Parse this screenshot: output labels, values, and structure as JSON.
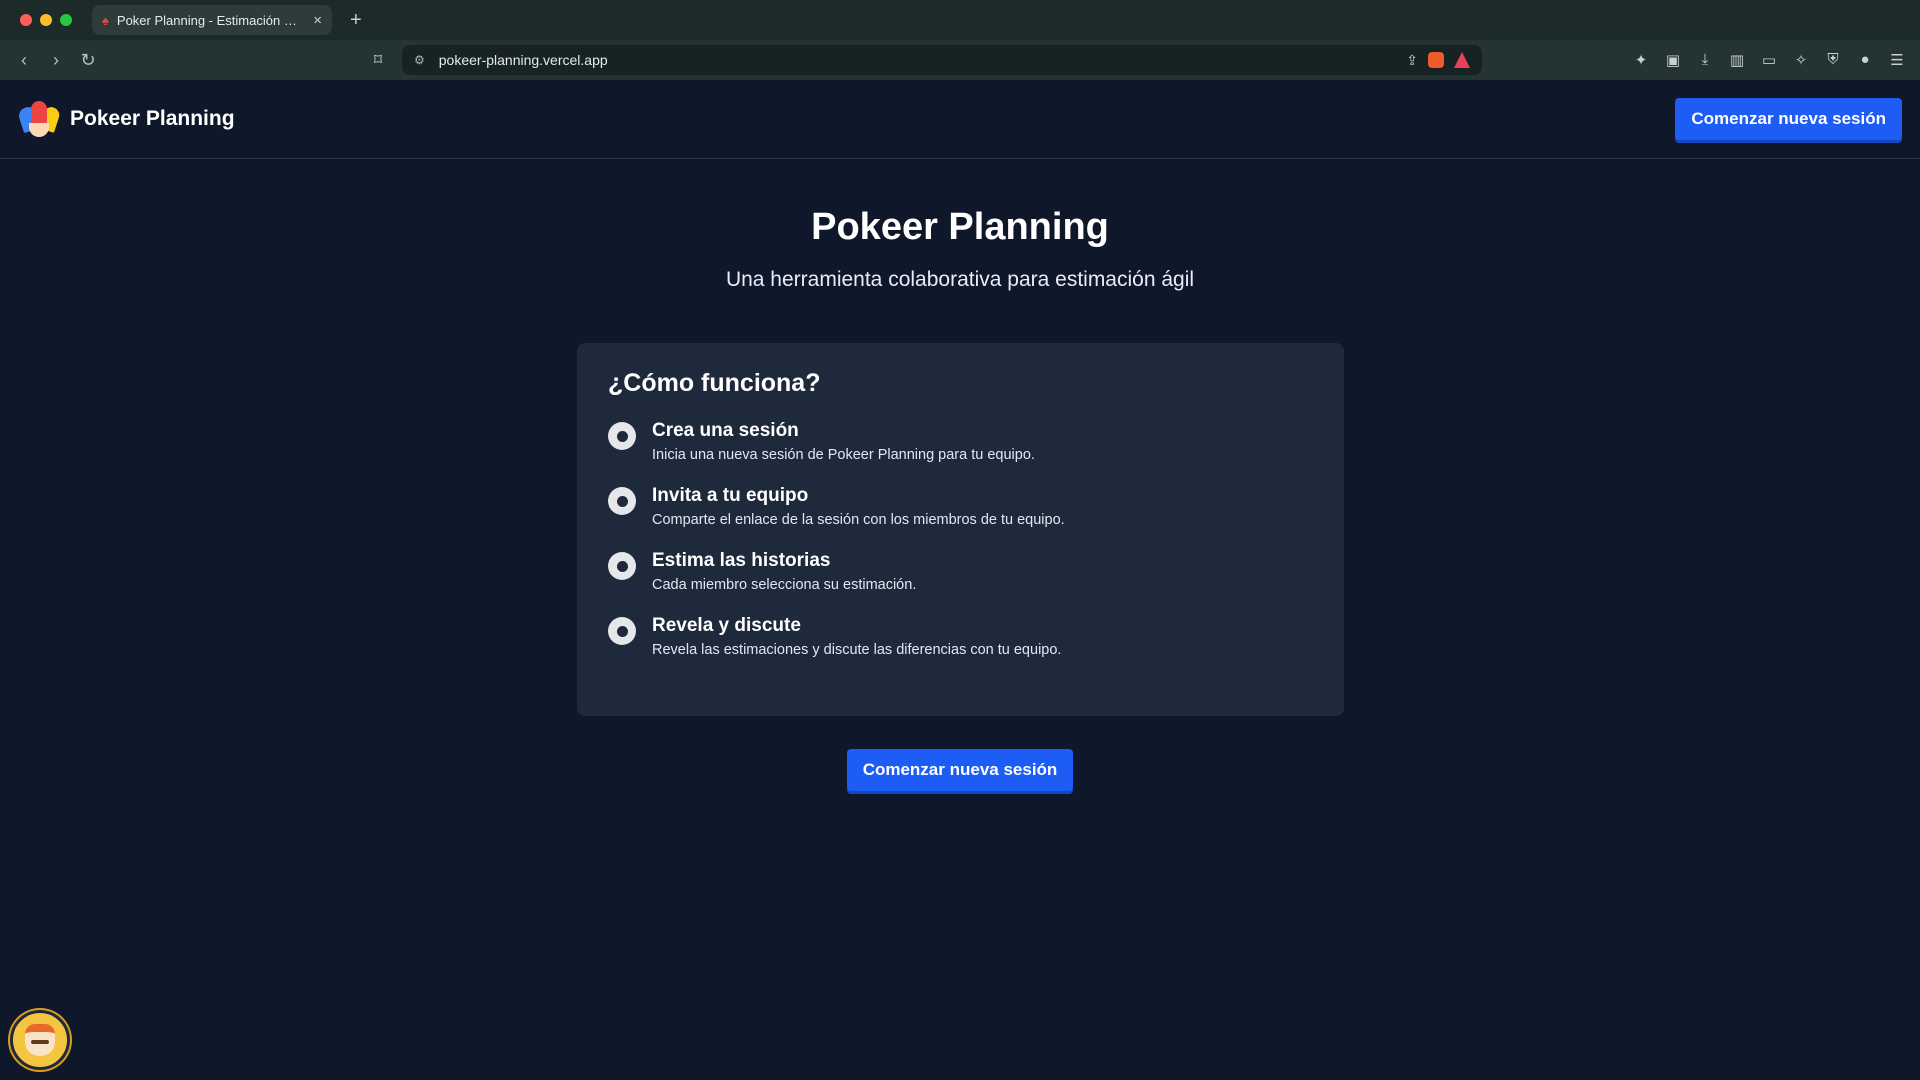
{
  "browser": {
    "tab_title": "Poker Planning - Estimación Ágil",
    "tab_close_glyph": "×",
    "new_tab_glyph": "+",
    "url": "pokeer-planning.vercel.app",
    "traffic_colors": [
      "#ff5f57",
      "#febc2e",
      "#28c840"
    ]
  },
  "header": {
    "brand": "Pokeer Planning",
    "cta_label": "Comenzar nueva sesión"
  },
  "hero": {
    "title": "Pokeer Planning",
    "subtitle": "Una herramienta colaborativa para estimación ágil"
  },
  "how_it_works": {
    "title": "¿Cómo funciona?",
    "steps": [
      {
        "title": "Crea una sesión",
        "description": "Inicia una nueva sesión de Pokeer Planning para tu equipo."
      },
      {
        "title": "Invita a tu equipo",
        "description": "Comparte el enlace de la sesión con los miembros de tu equipo."
      },
      {
        "title": "Estima las historias",
        "description": "Cada miembro selecciona su estimación."
      },
      {
        "title": "Revela y discute",
        "description": "Revela las estimaciones y discute las diferencias con tu equipo."
      }
    ]
  },
  "main": {
    "cta_label": "Comenzar nueva sesión"
  },
  "colors": {
    "background": "#0f172a",
    "card": "#1e293b",
    "accent": "#1d5cf5"
  }
}
